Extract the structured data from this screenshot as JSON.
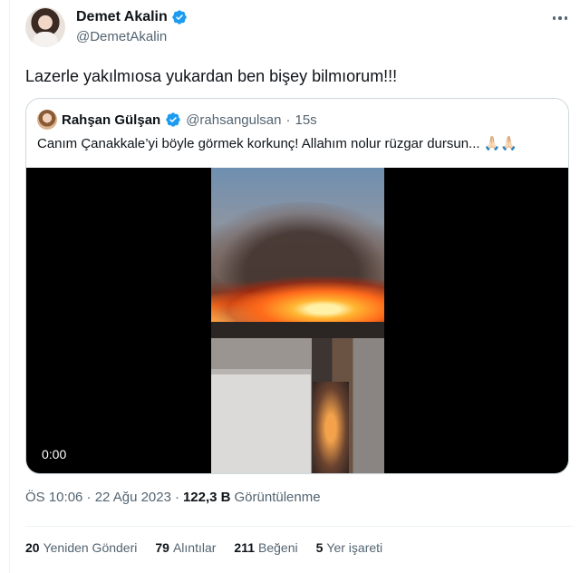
{
  "tweet": {
    "display_name": "Demet Akalin",
    "handle": "@DemetAkalin",
    "verified": true,
    "text": "Lazerle yakılmıosa yukardan ben bişey bilmıorum!!!",
    "more_icon": "more-horizontal-icon"
  },
  "quoted": {
    "display_name": "Rahşan Gülşan",
    "handle": "@rahsangulsan",
    "separator": "·",
    "time": "15s",
    "text": "Canım Çanakkale’yi böyle görmek korkunç! Allahım nolur rüzgar dursun...",
    "emoji": "🙏🏻🙏🏻",
    "video_time": "0:00"
  },
  "meta": {
    "timestamp": "ÖS 10:06 · 22 Ağu 2023",
    "separator": "·",
    "views_count": "122,3 B",
    "views_label": "Görüntülenme"
  },
  "stats": [
    {
      "count": "20",
      "label": "Yeniden Gönderi"
    },
    {
      "count": "79",
      "label": "Alıntılar"
    },
    {
      "count": "211",
      "label": "Beğeni"
    },
    {
      "count": "5",
      "label": "Yer işareti"
    }
  ],
  "colors": {
    "verified": "#1d9bf0",
    "secondary_text": "#536471",
    "border": "#cfd9de"
  }
}
